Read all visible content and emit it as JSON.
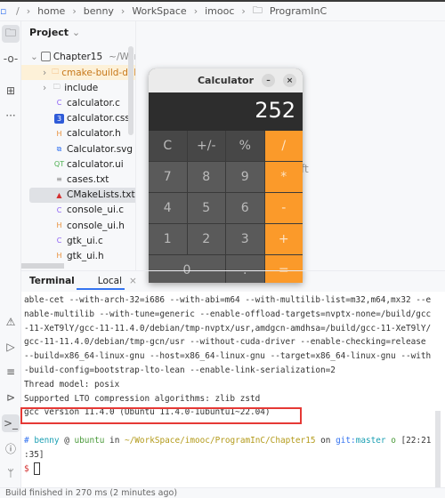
{
  "breadcrumb": [
    "home",
    "benny",
    "WorkSpace",
    "imooc",
    "ProgramInC"
  ],
  "project": {
    "title": "Project",
    "root": "Chapter15",
    "root_path": "~/WorkSpace",
    "items": [
      {
        "name": "cmake-build-debug",
        "kind": "folder",
        "highlighted": true
      },
      {
        "name": "include",
        "kind": "folder"
      },
      {
        "name": "calculator.c",
        "kind": "c"
      },
      {
        "name": "calculator.css",
        "kind": "css"
      },
      {
        "name": "calculator.h",
        "kind": "h"
      },
      {
        "name": "Calculator.svg",
        "kind": "svg"
      },
      {
        "name": "calculator.ui",
        "kind": "qt"
      },
      {
        "name": "cases.txt",
        "kind": "txt"
      },
      {
        "name": "CMakeLists.txt",
        "kind": "cmake",
        "selected": true
      },
      {
        "name": "console_ui.c",
        "kind": "c"
      },
      {
        "name": "console_ui.h",
        "kind": "h"
      },
      {
        "name": "gtk_ui.c",
        "kind": "c"
      },
      {
        "name": "gtk_ui.h",
        "kind": "h"
      }
    ]
  },
  "editor": {
    "ghost_text": "ft"
  },
  "calculator": {
    "title": "Calculator",
    "minimize": "–",
    "close": "×",
    "display": "252",
    "keys": [
      "C",
      "+/-",
      "%",
      "/",
      "7",
      "8",
      "9",
      "*",
      "4",
      "5",
      "6",
      "-",
      "1",
      "2",
      "3",
      "+",
      "0",
      ".",
      "="
    ],
    "accent": "#fb9a2a"
  },
  "terminal": {
    "tab_label": "Terminal",
    "session_label": "Local",
    "close": "×",
    "lines": [
      "able-cet --with-arch-32=i686 --with-abi=m64 --with-multilib-list=m32,m64,mx32 --e",
      "nable-multilib --with-tune=generic --enable-offload-targets=nvptx-none=/build/gcc",
      "-11-XeT9lY/gcc-11-11.4.0/debian/tmp-nvptx/usr,amdgcn-amdhsa=/build/gcc-11-XeT9lY/",
      "gcc-11-11.4.0/debian/tmp-gcn/usr --without-cuda-driver --enable-checking=release",
      "--build=x86_64-linux-gnu --host=x86_64-linux-gnu --target=x86_64-linux-gnu --with",
      "-build-config=bootstrap-lto-lean --enable-link-serialization=2",
      "Thread model: posix",
      "Supported LTO compression algorithms: zlib zstd",
      "gcc version 11.4.0 (Ubuntu 11.4.0-1ubuntu1~22.04)"
    ],
    "prompt": {
      "hash": "#",
      "user": "benny",
      "at": "@",
      "host": "ubuntu",
      "in": "in",
      "path": "~/WorkSpace/imooc/ProgramInC/Chapter15",
      "on": "on",
      "git_label": "git:",
      "branch": "master",
      "state": "o",
      "time1": "[22:21",
      "time2": ":35]",
      "dollar": "$"
    }
  },
  "status": "Build finished in 270 ms (2 minutes ago)"
}
